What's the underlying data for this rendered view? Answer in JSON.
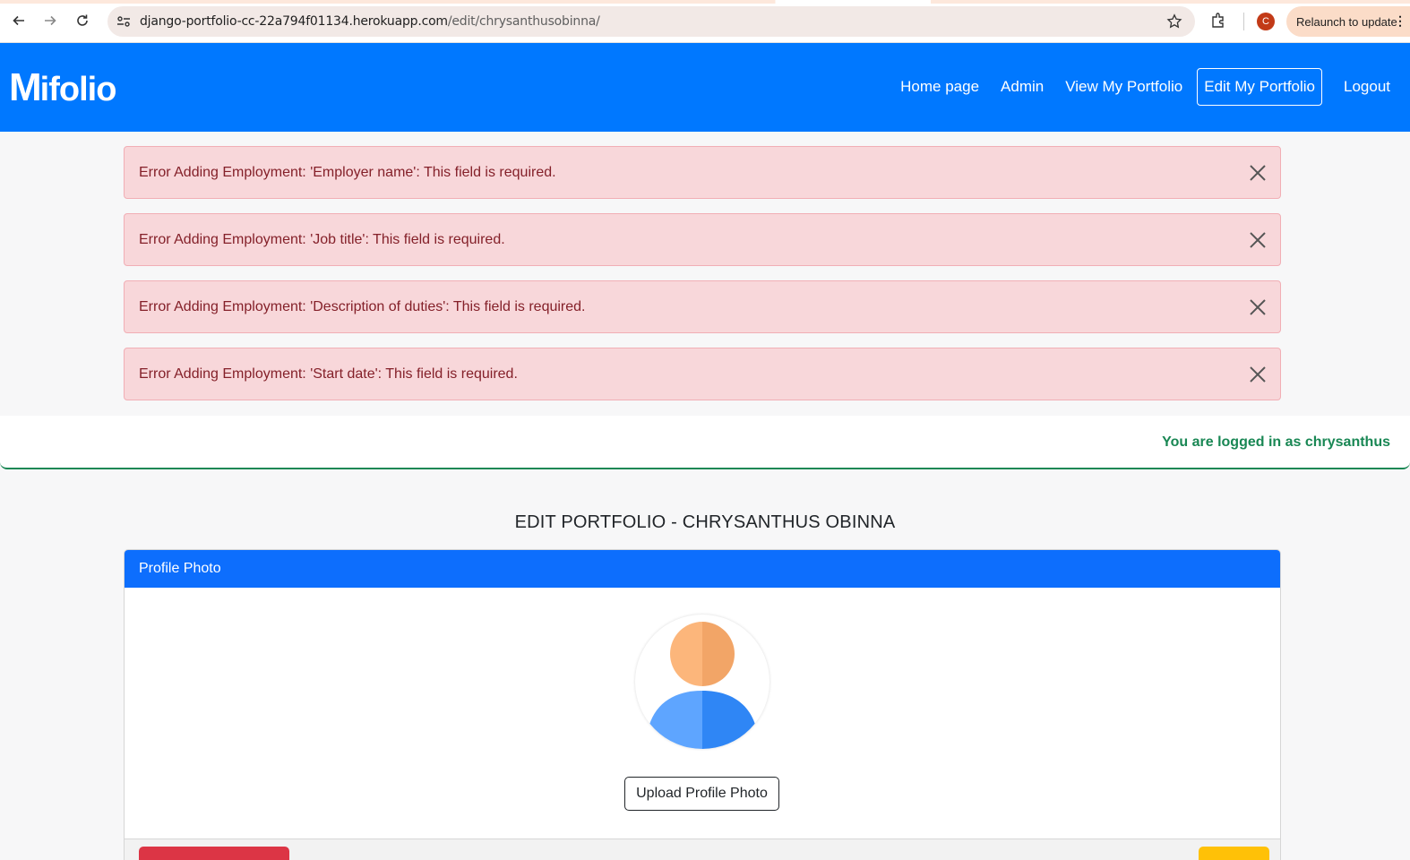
{
  "browser": {
    "url_domain": "django-portfolio-cc-22a794f01134.herokuapp.com",
    "url_path": "/edit/chrysanthusobinna/",
    "profile_initial": "C",
    "relaunch_label": "Relaunch to update"
  },
  "navbar": {
    "logo_first": "M",
    "logo_rest": "ifolio",
    "links": {
      "home": "Home page",
      "admin": "Admin",
      "view": "View My Portfolio",
      "edit": "Edit My Portfolio",
      "logout": "Logout"
    }
  },
  "alerts": [
    "Error Adding Employment: 'Employer name': This field is required.",
    "Error Adding Employment: 'Job title': This field is required.",
    "Error Adding Employment: 'Description of duties': This field is required.",
    "Error Adding Employment: 'Start date': This field is required."
  ],
  "logged_in_message": "You are logged in as chrysanthus",
  "page_title": "EDIT PORTFOLIO - CHRYSANTHUS OBINNA",
  "profile_card": {
    "header": "Profile Photo",
    "upload_label": "Upload Profile Photo"
  },
  "colors": {
    "brand": "#0078ff",
    "card_header": "#0d6efd",
    "alert_bg": "#f8d7da",
    "alert_text": "#842029",
    "success": "#198754",
    "danger": "#dc3545",
    "warning": "#ffc107"
  }
}
